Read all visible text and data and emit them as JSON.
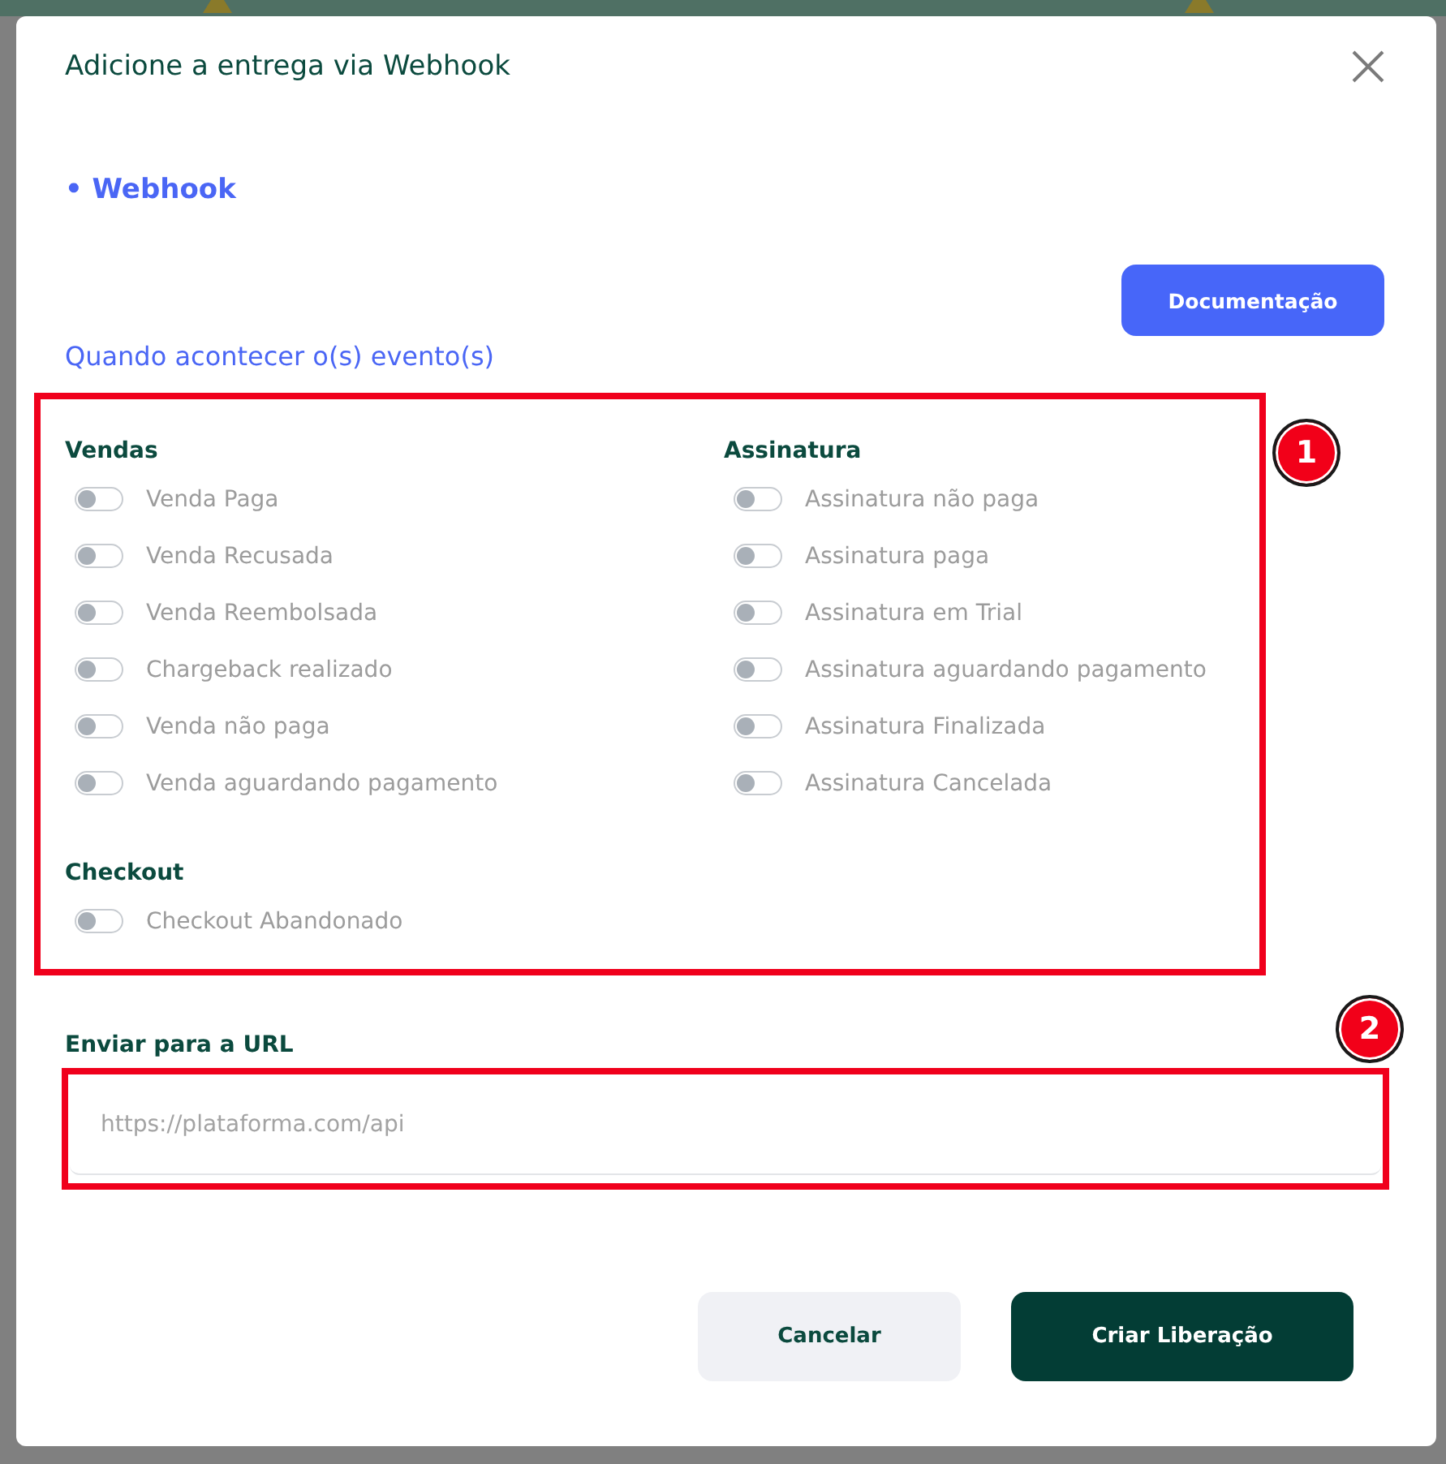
{
  "modal": {
    "title": "Adicione a entrega via Webhook",
    "section": "• Webhook",
    "docs_button": "Documentação",
    "events_heading": "Quando acontecer o(s) evento(s)",
    "event_groups": [
      {
        "title": "Vendas",
        "events": [
          {
            "label": "Venda Paga",
            "on": false
          },
          {
            "label": "Venda Recusada",
            "on": false
          },
          {
            "label": "Venda Reembolsada",
            "on": false
          },
          {
            "label": "Chargeback realizado",
            "on": false
          },
          {
            "label": "Venda não paga",
            "on": false
          },
          {
            "label": "Venda aguardando pagamento",
            "on": false
          }
        ]
      },
      {
        "title": "Assinatura",
        "events": [
          {
            "label": "Assinatura não paga",
            "on": false
          },
          {
            "label": "Assinatura paga",
            "on": false
          },
          {
            "label": "Assinatura em Trial",
            "on": false
          },
          {
            "label": "Assinatura aguardando pagamento",
            "on": false
          },
          {
            "label": "Assinatura Finalizada",
            "on": false
          },
          {
            "label": "Assinatura Cancelada",
            "on": false
          }
        ]
      },
      {
        "title": "Checkout",
        "events": [
          {
            "label": "Checkout Abandonado",
            "on": false
          }
        ]
      }
    ],
    "url_field": {
      "label": "Enviar para a URL",
      "placeholder": "https://plataforma.com/api"
    },
    "buttons": [
      {
        "label": "Cancelar",
        "kind": "secondary"
      },
      {
        "label": "Criar Liberação",
        "kind": "primary"
      }
    ]
  },
  "annotations": [
    {
      "number": "1"
    },
    {
      "number": "2"
    }
  ]
}
